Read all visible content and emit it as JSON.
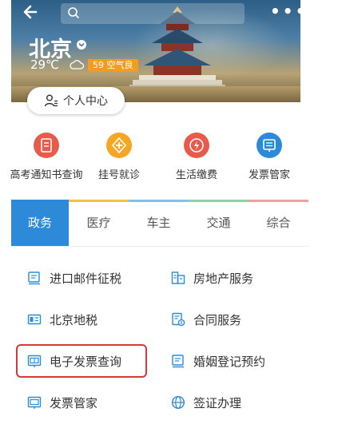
{
  "header": {
    "city": "北京",
    "temperature": "29℃",
    "air_quality": "59 空气良",
    "personal_center_label": "个人中心"
  },
  "quick_services": [
    {
      "label": "高考通知书查询",
      "icon": "document-icon",
      "color": "#e85a4a"
    },
    {
      "label": "挂号就诊",
      "icon": "medical-cross-icon",
      "color": "#f5a623"
    },
    {
      "label": "生活缴费",
      "icon": "flame-icon",
      "color": "#e85a4a"
    },
    {
      "label": "发票管家",
      "icon": "invoice-icon",
      "color": "#2c8ad8"
    }
  ],
  "tabs": [
    {
      "label": "政务",
      "active": true,
      "bar_color": "#2c8ad8"
    },
    {
      "label": "医疗",
      "active": false,
      "bar_color": "#f5c04a"
    },
    {
      "label": "车主",
      "active": false,
      "bar_color": "#7ec4e8"
    },
    {
      "label": "交通",
      "active": false,
      "bar_color": "#8fd0a8"
    },
    {
      "label": "综合",
      "active": false,
      "bar_color": "#f0a0a0"
    }
  ],
  "services": [
    {
      "label": "进口邮件征税",
      "icon": "mail-tax-icon"
    },
    {
      "label": "房地产服务",
      "icon": "building-icon"
    },
    {
      "label": "北京地税",
      "icon": "tax-card-icon"
    },
    {
      "label": "合同服务",
      "icon": "contract-icon"
    },
    {
      "label": "电子发票查询",
      "icon": "e-invoice-icon"
    },
    {
      "label": "婚姻登记预约",
      "icon": "marriage-doc-icon"
    },
    {
      "label": "发票管家",
      "icon": "invoice-icon"
    },
    {
      "label": "签证办理",
      "icon": "globe-icon"
    }
  ],
  "colors": {
    "accent_blue": "#2c8ad8",
    "highlight_red": "#d9363e",
    "aqi_orange": "#f39c1f"
  }
}
